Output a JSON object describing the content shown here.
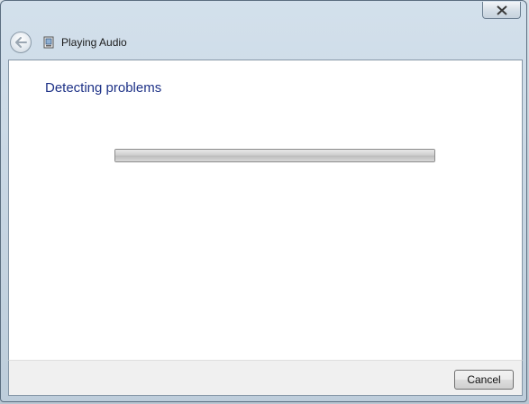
{
  "window": {
    "nav_title": "Playing Audio",
    "close_icon": "close-icon",
    "back_icon": "back-arrow-icon",
    "app_icon": "troubleshooter-icon"
  },
  "main": {
    "heading": "Detecting problems",
    "progress": 1.0
  },
  "footer": {
    "cancel_label": "Cancel"
  }
}
